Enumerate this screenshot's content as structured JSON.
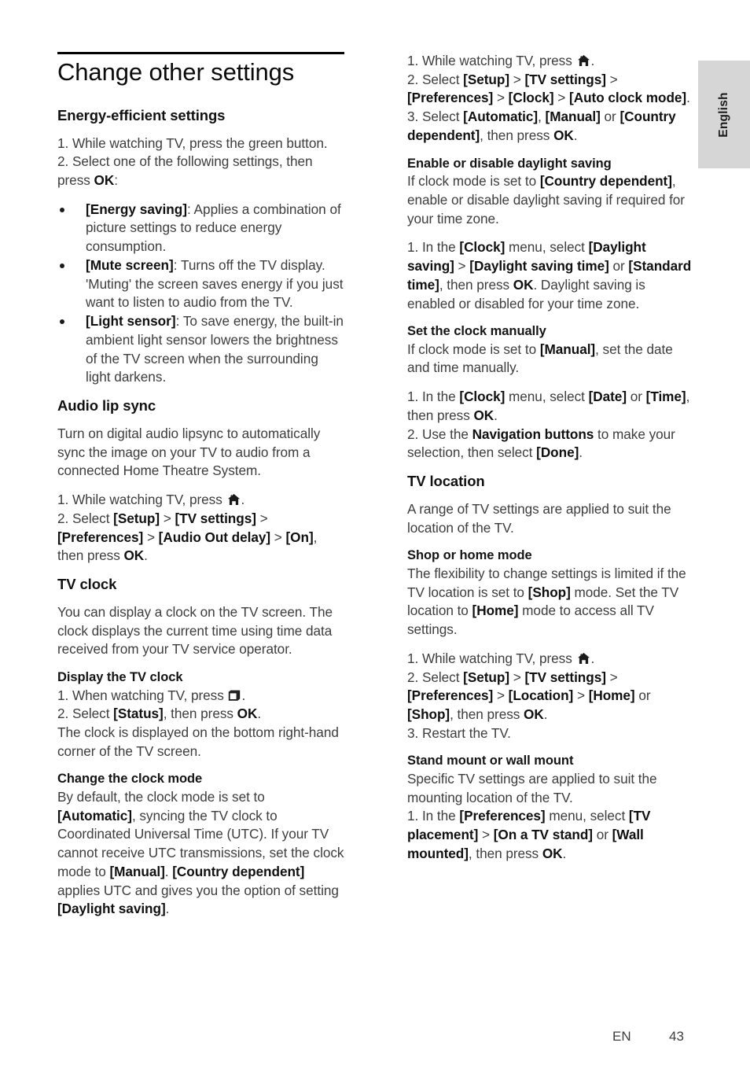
{
  "page": {
    "language_tab": "English",
    "footer_locale": "EN",
    "footer_page_number": "43",
    "chapter_title": "Change other settings"
  },
  "icons": {
    "home": "home-icon",
    "options": "options-icon"
  },
  "left_column": {
    "energy": {
      "heading": "Energy-efficient settings",
      "step1": "1. While watching TV, press the green button.",
      "step2_a": "2. Select one of the following settings, then press ",
      "step2_ok": "OK",
      "step2_b": ":",
      "bullets": [
        {
          "term": "[Energy saving]",
          "desc": ": Applies a combination of picture settings to reduce energy consumption."
        },
        {
          "term": "[Mute screen]",
          "desc": ": Turns off the TV display. 'Muting' the screen saves energy if you just want to listen to audio from the TV."
        },
        {
          "term": "[Light sensor]",
          "desc": ": To save energy, the built-in ambient light sensor lowers the brightness of the TV screen when the surrounding light darkens."
        }
      ]
    },
    "lipsync": {
      "heading": "Audio lip sync",
      "intro": "Turn on digital audio lipsync to automatically sync the image on your TV to audio from a connected Home Theatre System.",
      "step1_a": "1. While watching TV, press ",
      "step1_b": ".",
      "step2_pre": "2. Select ",
      "step2_setup": "[Setup]",
      "step2_gt1": " > ",
      "step2_tvsettings": "[TV settings]",
      "step2_gt2": " > ",
      "step2_prefs": "[Preferences]",
      "step2_gt3": " > ",
      "step2_audioout": "[Audio Out delay]",
      "step2_gt4": " > ",
      "step2_on": "[On]",
      "step2_then": ", then press ",
      "step2_ok": "OK",
      "step2_end": "."
    },
    "tvclock": {
      "heading": "TV clock",
      "intro": "You can display a clock on the TV screen. The clock displays the current time using time data received from your TV service operator.",
      "display": {
        "heading": "Display the TV clock",
        "step1_a": "1. When watching TV, press ",
        "step1_b": ".",
        "step2_pre": "2. Select ",
        "step2_status": "[Status]",
        "step2_mid": ", then press ",
        "step2_ok": "OK",
        "step2_end": ".",
        "step3": "The clock is displayed on the bottom right-hand corner of the TV screen."
      },
      "changemode": {
        "heading": "Change the clock mode",
        "t1": "By default, the clock mode is set to ",
        "b1": "[Automatic]",
        "t2": ", syncing the TV clock to Coordinated Universal Time (UTC). If your TV cannot receive UTC transmissions, set the clock mode to ",
        "b2": "[Manual]",
        "t3": ".  ",
        "b3": "[Country dependent]",
        "t4": " applies UTC and gives you the option of setting ",
        "b4": "[Daylight saving]",
        "t5": "."
      }
    }
  },
  "right_column": {
    "autoclock": {
      "step1_a": "1. While watching TV, press ",
      "step1_b": ".",
      "step2_pre": "2. Select ",
      "step2_setup": "[Setup]",
      "step2_gt1": " > ",
      "step2_tvsettings": "[TV settings]",
      "step2_gt2": " > ",
      "step2_prefs": "[Preferences]",
      "step2_gt3": " > ",
      "step2_clock": "[Clock]",
      "step2_gt4": " > ",
      "step2_autoclock": "[Auto clock mode]",
      "step2_end": ".",
      "step3_pre": "3. Select ",
      "step3_auto": "[Automatic]",
      "step3_c1": ", ",
      "step3_manual": "[Manual]",
      "step3_or": " or ",
      "step3_country": "[Country dependent]",
      "step3_then": ", then press ",
      "step3_ok": "OK",
      "step3_end": "."
    },
    "daylight": {
      "heading": "Enable or disable daylight saving",
      "p1_a": "If clock mode is set to ",
      "p1_b": "[Country dependent]",
      "p1_c": ", enable or disable daylight saving if required for your time zone.",
      "s1_pre": "1. In the ",
      "s1_clock": "[Clock]",
      "s1_mid": " menu, select ",
      "s1_daylight": "[Daylight saving]",
      "s1_gt": " > ",
      "s1_dst": "[Daylight saving time]",
      "s1_or": " or ",
      "s1_std": "[Standard time]",
      "s1_then": ", then press ",
      "s1_ok": "OK",
      "s1_end": ". Daylight saving is enabled or disabled for your time zone."
    },
    "manualclock": {
      "heading": "Set the clock manually",
      "p1_a": "If clock mode is set to ",
      "p1_b": "[Manual]",
      "p1_c": ", set the date and time manually.",
      "s1_pre": "1. In the ",
      "s1_clock": "[Clock]",
      "s1_mid": " menu, select ",
      "s1_date": "[Date]",
      "s1_or": " or ",
      "s1_time": "[Time]",
      "s1_then": ", then press ",
      "s1_ok": "OK",
      "s1_end": ".",
      "s2_pre": "2. Use the ",
      "s2_nav": "Navigation buttons",
      "s2_mid": " to make your selection, then select ",
      "s2_done": "[Done]",
      "s2_end": "."
    },
    "tvlocation": {
      "heading": "TV location",
      "intro": "A range of TV settings are applied to suit the location of the TV.",
      "shophome": {
        "heading": "Shop or home mode",
        "t1": "The flexibility to change settings is limited if the TV location is set to ",
        "b1": "[Shop]",
        "t2": " mode. Set the TV location to ",
        "b2": "[Home]",
        "t3": " mode to access all TV settings.",
        "s1_a": "1. While watching TV, press ",
        "s1_b": ".",
        "s2_pre": "2. Select ",
        "s2_setup": "[Setup]",
        "s2_gt1": " > ",
        "s2_tvsettings": "[TV settings]",
        "s2_gt2": " > ",
        "s2_prefs": "[Preferences]",
        "s2_gt3": " > ",
        "s2_location": "[Location]",
        "s2_gt4": " > ",
        "s2_home": "[Home]",
        "s2_or": " or ",
        "s2_shop": "[Shop]",
        "s2_then": ", then press ",
        "s2_ok": "OK",
        "s2_end": ".",
        "s3": "3. Restart the TV."
      },
      "mount": {
        "heading": "Stand mount or wall mount",
        "intro": "Specific TV settings are applied to suit the mounting location of the TV.",
        "s1_pre": "1. In the ",
        "s1_prefs": "[Preferences]",
        "s1_mid": " menu, select ",
        "s1_placement": "[TV placement]",
        "s1_gt": " > ",
        "s1_stand": "[On a TV stand]",
        "s1_or": " or ",
        "s1_wall": "[Wall mounted]",
        "s1_then": ", then press ",
        "s1_ok": "OK",
        "s1_end": "."
      }
    }
  }
}
